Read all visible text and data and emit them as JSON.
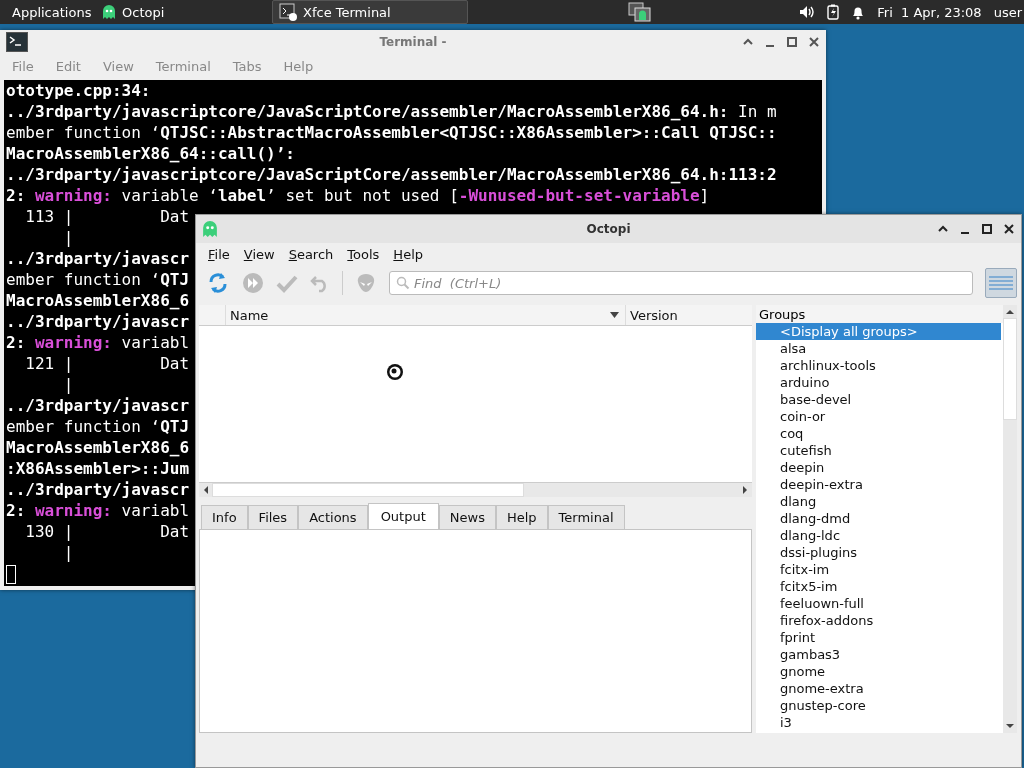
{
  "taskbar": {
    "apps_menu": "Applications",
    "tasks": [
      {
        "label": "Octopi",
        "selected": false,
        "kind": "ghost"
      },
      {
        "label": "Xfce Terminal",
        "selected": true,
        "kind": "terminal"
      }
    ],
    "clock": "Fri  1 Apr, 23:08",
    "user": "user"
  },
  "terminal_window": {
    "title": "Terminal -",
    "menu": [
      "File",
      "Edit",
      "View",
      "Terminal",
      "Tabs",
      "Help"
    ],
    "lines": [
      [
        {
          "kind": "bold",
          "text": "ototype.cpp:34:"
        }
      ],
      [
        {
          "kind": "bold",
          "text": "../3rdparty/javascriptcore/JavaScriptCore/assembler/MacroAssemblerX86_64.h:"
        },
        {
          "kind": "plain",
          "text": " In m"
        }
      ],
      [
        {
          "kind": "plain",
          "text": "ember function ‘"
        },
        {
          "kind": "bold",
          "text": "QTJSC::AbstractMacroAssembler<QTJSC::X86Assembler>::Call QTJSC::"
        }
      ],
      [
        {
          "kind": "bold",
          "text": "MacroAssemblerX86_64::call()’:"
        }
      ],
      [
        {
          "kind": "bold",
          "text": "../3rdparty/javascriptcore/JavaScriptCore/assembler/MacroAssemblerX86_64.h:113:2"
        }
      ],
      [
        {
          "kind": "bold",
          "text": "2: "
        },
        {
          "kind": "warn",
          "text": "warning:"
        },
        {
          "kind": "plain",
          "text": " variable ‘"
        },
        {
          "kind": "bold",
          "text": "label"
        },
        {
          "kind": "plain",
          "text": "’ set but not used ["
        },
        {
          "kind": "warn",
          "text": "-Wunused-but-set-variable"
        },
        {
          "kind": "plain",
          "text": "]"
        }
      ],
      [
        {
          "kind": "plain",
          "text": "  113 |         Dat"
        }
      ],
      [
        {
          "kind": "plain",
          "text": "      |"
        }
      ],
      [
        {
          "kind": "bold",
          "text": "../3rdparty/javascr"
        }
      ],
      [
        {
          "kind": "plain",
          "text": "ember function ‘"
        },
        {
          "kind": "bold",
          "text": "QTJ"
        }
      ],
      [
        {
          "kind": "bold",
          "text": "MacroAssemblerX86_6"
        }
      ],
      [
        {
          "kind": "bold",
          "text": "../3rdparty/javascr"
        }
      ],
      [
        {
          "kind": "bold",
          "text": "2: "
        },
        {
          "kind": "warn",
          "text": "warning:"
        },
        {
          "kind": "plain",
          "text": " variabl"
        }
      ],
      [
        {
          "kind": "plain",
          "text": "  121 |         Dat"
        }
      ],
      [
        {
          "kind": "plain",
          "text": "      |"
        }
      ],
      [
        {
          "kind": "bold",
          "text": "../3rdparty/javascr"
        }
      ],
      [
        {
          "kind": "plain",
          "text": "ember function ‘"
        },
        {
          "kind": "bold",
          "text": "QTJ"
        }
      ],
      [
        {
          "kind": "bold",
          "text": "MacroAssemblerX86_6"
        }
      ],
      [
        {
          "kind": "bold",
          "text": ":X86Assembler>::Jum"
        }
      ],
      [
        {
          "kind": "bold",
          "text": "../3rdparty/javascr"
        }
      ],
      [
        {
          "kind": "bold",
          "text": "2: "
        },
        {
          "kind": "warn",
          "text": "warning:"
        },
        {
          "kind": "plain",
          "text": " variabl"
        }
      ],
      [
        {
          "kind": "plain",
          "text": "  130 |         Dat"
        }
      ],
      [
        {
          "kind": "plain",
          "text": "      |"
        }
      ]
    ]
  },
  "octopi_window": {
    "title": "Octopi",
    "menu": [
      "File",
      "View",
      "Search",
      "Tools",
      "Help"
    ],
    "search": {
      "placeholder": "Find  (Ctrl+L)"
    },
    "package_table": {
      "columns": [
        "Name",
        "Version"
      ]
    },
    "tabs": [
      {
        "label": "Info",
        "selected": false
      },
      {
        "label": "Files",
        "selected": false
      },
      {
        "label": "Actions",
        "selected": false
      },
      {
        "label": "Output",
        "selected": true
      },
      {
        "label": "News",
        "selected": false
      },
      {
        "label": "Help",
        "selected": false
      },
      {
        "label": "Terminal",
        "selected": false
      }
    ],
    "groups": {
      "header": "Groups",
      "items": [
        {
          "label": "<Display all groups>",
          "selected": true
        },
        {
          "label": "alsa",
          "selected": false
        },
        {
          "label": "archlinux-tools",
          "selected": false
        },
        {
          "label": "arduino",
          "selected": false
        },
        {
          "label": "base-devel",
          "selected": false
        },
        {
          "label": "coin-or",
          "selected": false
        },
        {
          "label": "coq",
          "selected": false
        },
        {
          "label": "cutefish",
          "selected": false
        },
        {
          "label": "deepin",
          "selected": false
        },
        {
          "label": "deepin-extra",
          "selected": false
        },
        {
          "label": "dlang",
          "selected": false
        },
        {
          "label": "dlang-dmd",
          "selected": false
        },
        {
          "label": "dlang-ldc",
          "selected": false
        },
        {
          "label": "dssi-plugins",
          "selected": false
        },
        {
          "label": "fcitx-im",
          "selected": false
        },
        {
          "label": "fcitx5-im",
          "selected": false
        },
        {
          "label": "feeluown-full",
          "selected": false
        },
        {
          "label": "firefox-addons",
          "selected": false
        },
        {
          "label": "fprint",
          "selected": false
        },
        {
          "label": "gambas3",
          "selected": false
        },
        {
          "label": "gnome",
          "selected": false
        },
        {
          "label": "gnome-extra",
          "selected": false
        },
        {
          "label": "gnustep-core",
          "selected": false
        },
        {
          "label": "i3",
          "selected": false
        }
      ]
    }
  }
}
